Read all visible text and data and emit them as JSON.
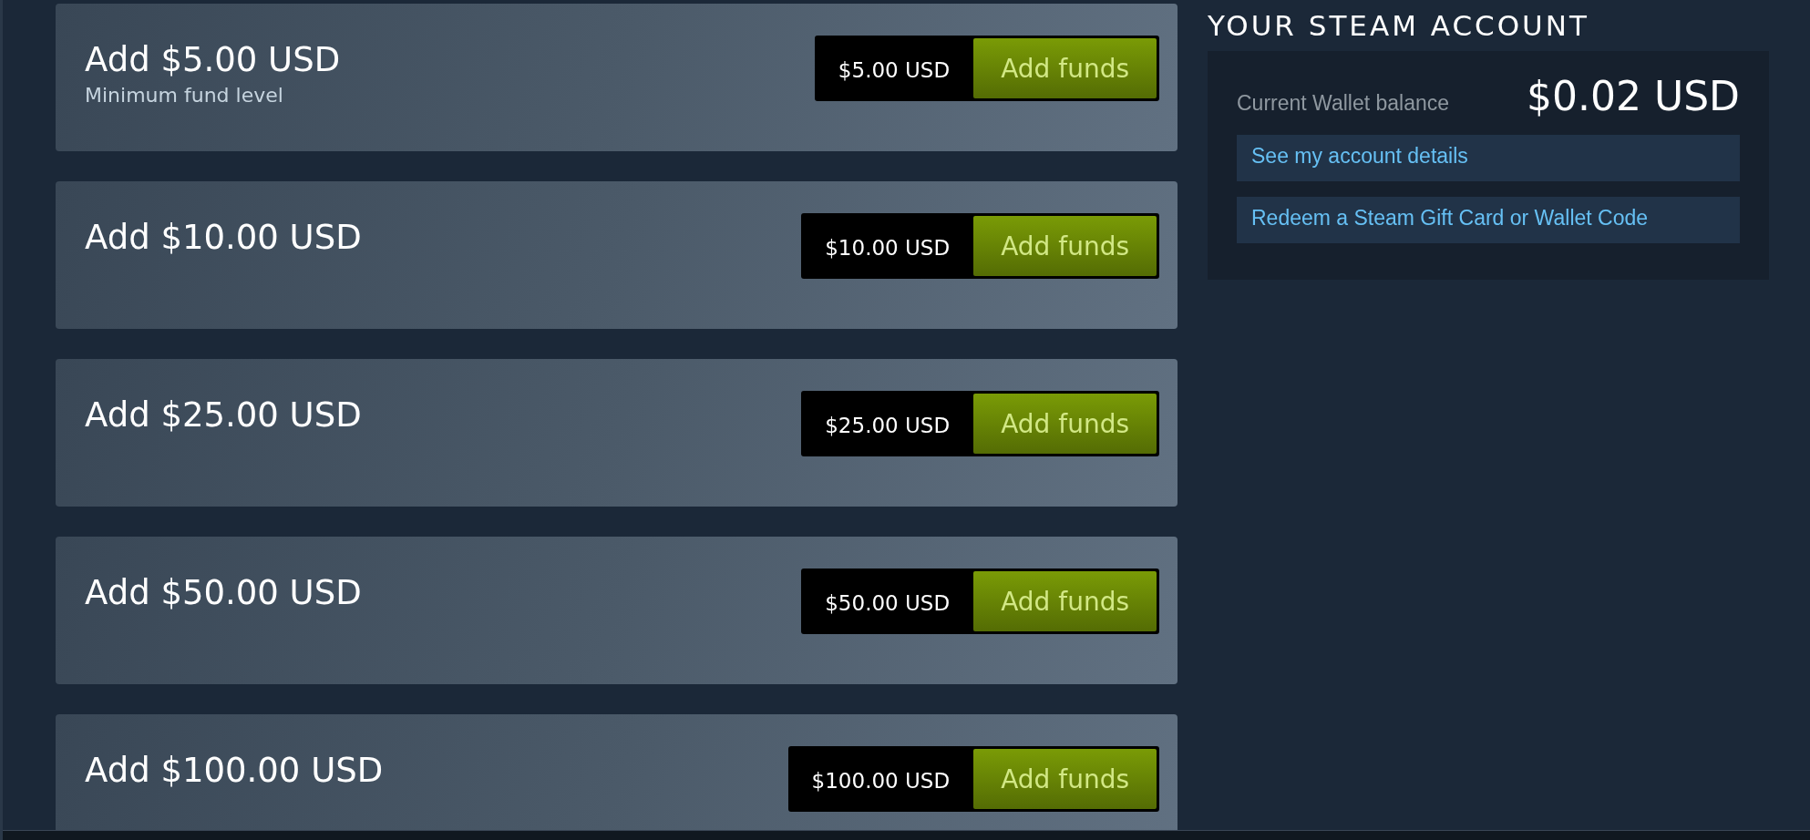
{
  "options": [
    {
      "title": "Add $5.00 USD",
      "subtitle": "Minimum fund level",
      "price": "$5.00 USD",
      "button": "Add funds"
    },
    {
      "title": "Add $10.00 USD",
      "price": "$10.00 USD",
      "button": "Add funds"
    },
    {
      "title": "Add $25.00 USD",
      "price": "$25.00 USD",
      "button": "Add funds"
    },
    {
      "title": "Add $50.00 USD",
      "price": "$50.00 USD",
      "button": "Add funds"
    },
    {
      "title": "Add $100.00 USD",
      "price": "$100.00 USD",
      "button": "Add funds"
    }
  ],
  "account": {
    "title": "YOUR STEAM ACCOUNT",
    "balance_label": "Current Wallet balance",
    "balance": "$0.02 USD",
    "links": [
      "See my account details",
      "Redeem a Steam Gift Card or Wallet Code"
    ]
  }
}
